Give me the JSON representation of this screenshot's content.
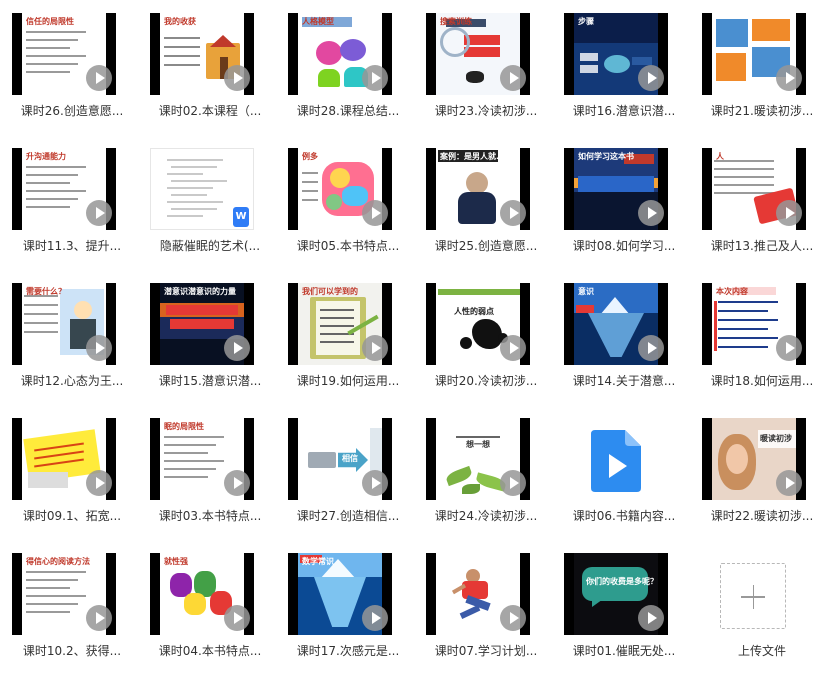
{
  "files": [
    {
      "label": "课时26.创造意愿...",
      "slide": {
        "title": "信任的局限性",
        "theme": "white"
      }
    },
    {
      "label": "课时02.本课程（...",
      "slide": {
        "title": "我的收获",
        "theme": "white-house"
      }
    },
    {
      "label": "课时28.课程总结...",
      "slide": {
        "title": "人格模型",
        "theme": "ph-em"
      }
    },
    {
      "label": "课时23.冷读初涉...",
      "slide": {
        "title": "搜索训练",
        "theme": "magnifier"
      }
    },
    {
      "label": "课时16.潜意识潜...",
      "slide": {
        "title": "步骤",
        "theme": "dark-blue"
      }
    },
    {
      "label": "课时21.暖读初涉...",
      "slide": {
        "title": "",
        "theme": "orange-boxes"
      }
    },
    {
      "label": "课时11.3、提升...",
      "slide": {
        "title": "升沟通能力",
        "theme": "white"
      }
    },
    {
      "label": "隐蔽催眠的艺术(...",
      "slide": {
        "title": "",
        "theme": "doc"
      }
    },
    {
      "label": "课时05.本书特点...",
      "slide": {
        "title": "例多",
        "theme": "colorful"
      }
    },
    {
      "label": "课时25.创造意愿...",
      "slide": {
        "title": "案例：是男人就...",
        "theme": "man"
      }
    },
    {
      "label": "课时08.如何学习...",
      "slide": {
        "title": "如何学习这本书",
        "theme": "sunset"
      }
    },
    {
      "label": "课时13.推己及人...",
      "slide": {
        "title": "人",
        "theme": "white-banner"
      }
    },
    {
      "label": "课时12.心态为王...",
      "slide": {
        "title": "需要什么？",
        "theme": "cartoon"
      }
    },
    {
      "label": "课时15.潜意识潜...",
      "slide": {
        "title": "潜意识潜意识的力量",
        "theme": "sunset2"
      }
    },
    {
      "label": "课时19.如何运用...",
      "slide": {
        "title": "我们可以学到的",
        "theme": "notebook"
      }
    },
    {
      "label": "课时20.冷读初涉...",
      "slide": {
        "title": "人性的弱点",
        "theme": "splash"
      }
    },
    {
      "label": "课时14.关于潜意...",
      "slide": {
        "title": "意识",
        "theme": "iceberg"
      }
    },
    {
      "label": "课时18.如何运用...",
      "slide": {
        "title": "本次内容",
        "theme": "list-red"
      }
    },
    {
      "label": "课时09.1、拓宽...",
      "slide": {
        "title": "",
        "theme": "yellow-note"
      }
    },
    {
      "label": "课时03.本书特点...",
      "slide": {
        "title": "眠的局限性",
        "theme": "white"
      }
    },
    {
      "label": "课时27.创造相信...",
      "slide": {
        "title": "相信",
        "theme": "arrow"
      }
    },
    {
      "label": "课时24.冷读初涉...",
      "slide": {
        "title": "想一想",
        "theme": "leaves"
      }
    },
    {
      "label": "课时06.书籍内容...",
      "slide": {
        "title": "",
        "theme": "video-icon"
      }
    },
    {
      "label": "课时22.暖读初涉...",
      "slide": {
        "title": "暖读初涉",
        "theme": "woman"
      }
    },
    {
      "label": "课时10.2、获得...",
      "slide": {
        "title": "得信心的阅读方法",
        "theme": "white"
      }
    },
    {
      "label": "课时04.本书特点...",
      "slide": {
        "title": "就性强",
        "theme": "hands"
      }
    },
    {
      "label": "课时17.次感元是...",
      "slide": {
        "title": "数学常识",
        "theme": "iceberg2"
      }
    },
    {
      "label": "课时07.学习计划...",
      "slide": {
        "title": "",
        "theme": "jumper"
      }
    },
    {
      "label": "课时01.催眠无处...",
      "slide": {
        "title": "你们的收费是多呢？",
        "theme": "dark-bubble"
      }
    },
    {
      "label": "上传文件",
      "slide": {
        "title": "",
        "theme": "upload"
      }
    }
  ]
}
